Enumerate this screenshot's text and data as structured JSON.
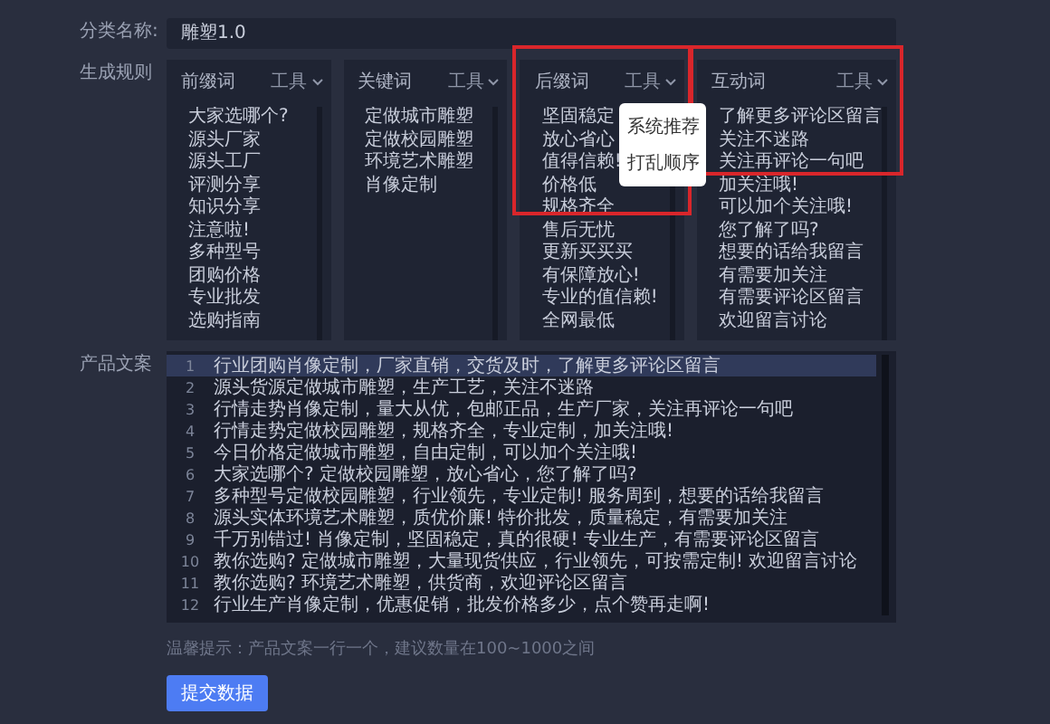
{
  "category": {
    "label": "分类名称:",
    "value": "雕塑1.0"
  },
  "rules": {
    "label": "生成规则",
    "cards": [
      {
        "title": "前缀词",
        "tool": "工具",
        "highlighted": false,
        "menu_open": false,
        "items": [
          "大家选哪个?",
          "源头厂家",
          "源头工厂",
          "评测分享",
          "知识分享",
          "注意啦!",
          "多种型号",
          "团购价格",
          "专业批发",
          "选购指南"
        ]
      },
      {
        "title": "关键词",
        "tool": "工具",
        "highlighted": false,
        "menu_open": false,
        "items": [
          "定做城市雕塑",
          "定做校园雕塑",
          "环境艺术雕塑",
          "肖像定制"
        ]
      },
      {
        "title": "后缀词",
        "tool": "工具",
        "highlighted": true,
        "menu_open": true,
        "menu": [
          "系统推荐",
          "打乱顺序"
        ],
        "items": [
          "坚固稳定",
          "放心省心",
          "值得信赖!",
          "价格低",
          "规格齐全",
          "售后无忧",
          "更新买买买",
          "有保障放心!",
          "专业的值信赖!",
          "全网最低"
        ]
      },
      {
        "title": "互动词",
        "tool": "工具",
        "highlighted": true,
        "menu_open": false,
        "items": [
          "了解更多评论区留言",
          "关注不迷路",
          "关注再评论一句吧",
          "加关注哦!",
          "可以加个关注哦!",
          "您了解了吗?",
          "想要的话给我留言",
          "有需要加关注",
          "有需要评论区留言",
          "欢迎留言讨论"
        ]
      }
    ]
  },
  "copy": {
    "label": "产品文案",
    "lines": [
      {
        "number": "1",
        "text": "行业团购肖像定制，厂家直销，交货及时，了解更多评论区留言",
        "selected": true
      },
      {
        "number": "2",
        "text": "源头货源定做城市雕塑，生产工艺，关注不迷路",
        "selected": false
      },
      {
        "number": "3",
        "text": "行情走势肖像定制，量大从优，包邮正品，生产厂家，关注再评论一句吧",
        "selected": false
      },
      {
        "number": "4",
        "text": "行情走势定做校园雕塑，规格齐全，专业定制，加关注哦!",
        "selected": false
      },
      {
        "number": "5",
        "text": "今日价格定做城市雕塑，自由定制，可以加个关注哦!",
        "selected": false
      },
      {
        "number": "6",
        "text": "大家选哪个? 定做校园雕塑，放心省心，您了解了吗?",
        "selected": false
      },
      {
        "number": "7",
        "text": "多种型号定做校园雕塑，行业领先，专业定制! 服务周到，想要的话给我留言",
        "selected": false
      },
      {
        "number": "8",
        "text": "源头实体环境艺术雕塑，质优价廉! 特价批发，质量稳定，有需要加关注",
        "selected": false
      },
      {
        "number": "9",
        "text": "千万别错过! 肖像定制，坚固稳定，真的很硬! 专业生产，有需要评论区留言",
        "selected": false
      },
      {
        "number": "10",
        "text": "教你选购? 定做城市雕塑，大量现货供应，行业领先，可按需定制! 欢迎留言讨论",
        "selected": false
      },
      {
        "number": "11",
        "text": "教你选购? 环境艺术雕塑，供货商，欢迎评论区留言",
        "selected": false
      },
      {
        "number": "12",
        "text": "行业生产肖像定制，优惠促销，批发价格多少，点个赞再走啊!",
        "selected": false
      }
    ],
    "hint": "温馨提示：产品文案一行一个，建议数量在100~1000之间"
  },
  "submit": "提交数据"
}
